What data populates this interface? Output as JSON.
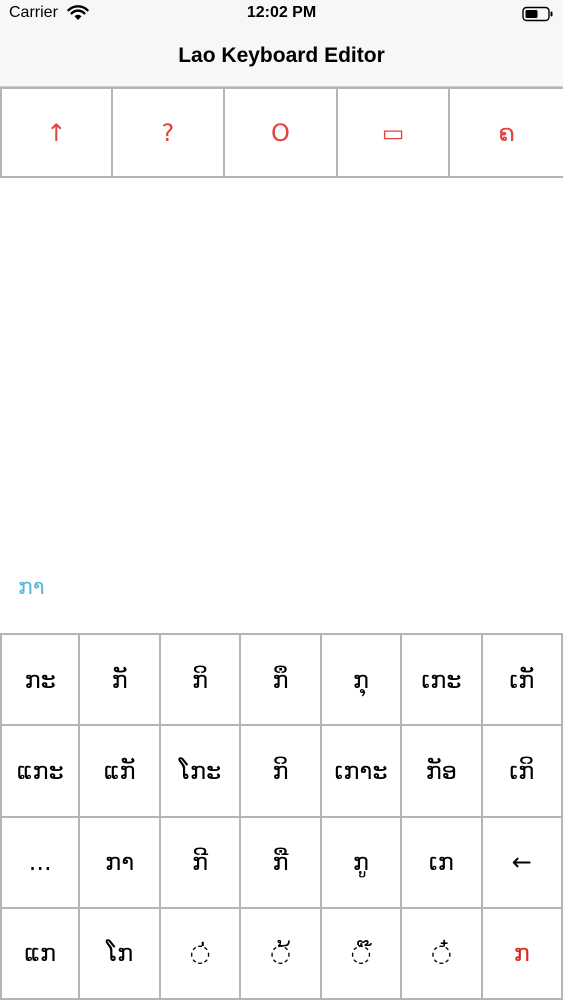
{
  "status_bar": {
    "carrier": "Carrier",
    "time": "12:02 PM"
  },
  "nav": {
    "title": "Lao Keyboard Editor"
  },
  "toolbar": {
    "buttons": [
      {
        "icon": "arrow-up-icon",
        "glyph": "↑"
      },
      {
        "icon": "question-icon",
        "glyph": "?"
      },
      {
        "icon": "circle-o-icon",
        "glyph": "O"
      },
      {
        "icon": "rounded-rect-icon",
        "glyph": "▭"
      },
      {
        "icon": "lao-char-icon",
        "glyph": "ຄ"
      }
    ],
    "accent_color": "#e0443a"
  },
  "editor": {
    "suggestion": "ກາ",
    "suggestion_color": "#5ab8e0"
  },
  "keyboard": {
    "rows": [
      [
        "ກະ",
        "ກັ",
        "ກິ",
        "ກຶ",
        "ກຸ",
        "ເກະ",
        "ເກັ"
      ],
      [
        "ແກະ",
        "ແກັ",
        "ໂກະ",
        "ກິ",
        "ເກາະ",
        "ກັອ",
        "ເກິ"
      ],
      [
        "...",
        "ກາ",
        "ກີ",
        "ກື",
        "ກູ",
        "ເກ",
        "←"
      ],
      [
        "ແກ",
        "ໂກ",
        "◌່",
        "◌້",
        "◌໊",
        "◌໋",
        "ກ"
      ]
    ],
    "last_key_color": "#d82a20"
  }
}
